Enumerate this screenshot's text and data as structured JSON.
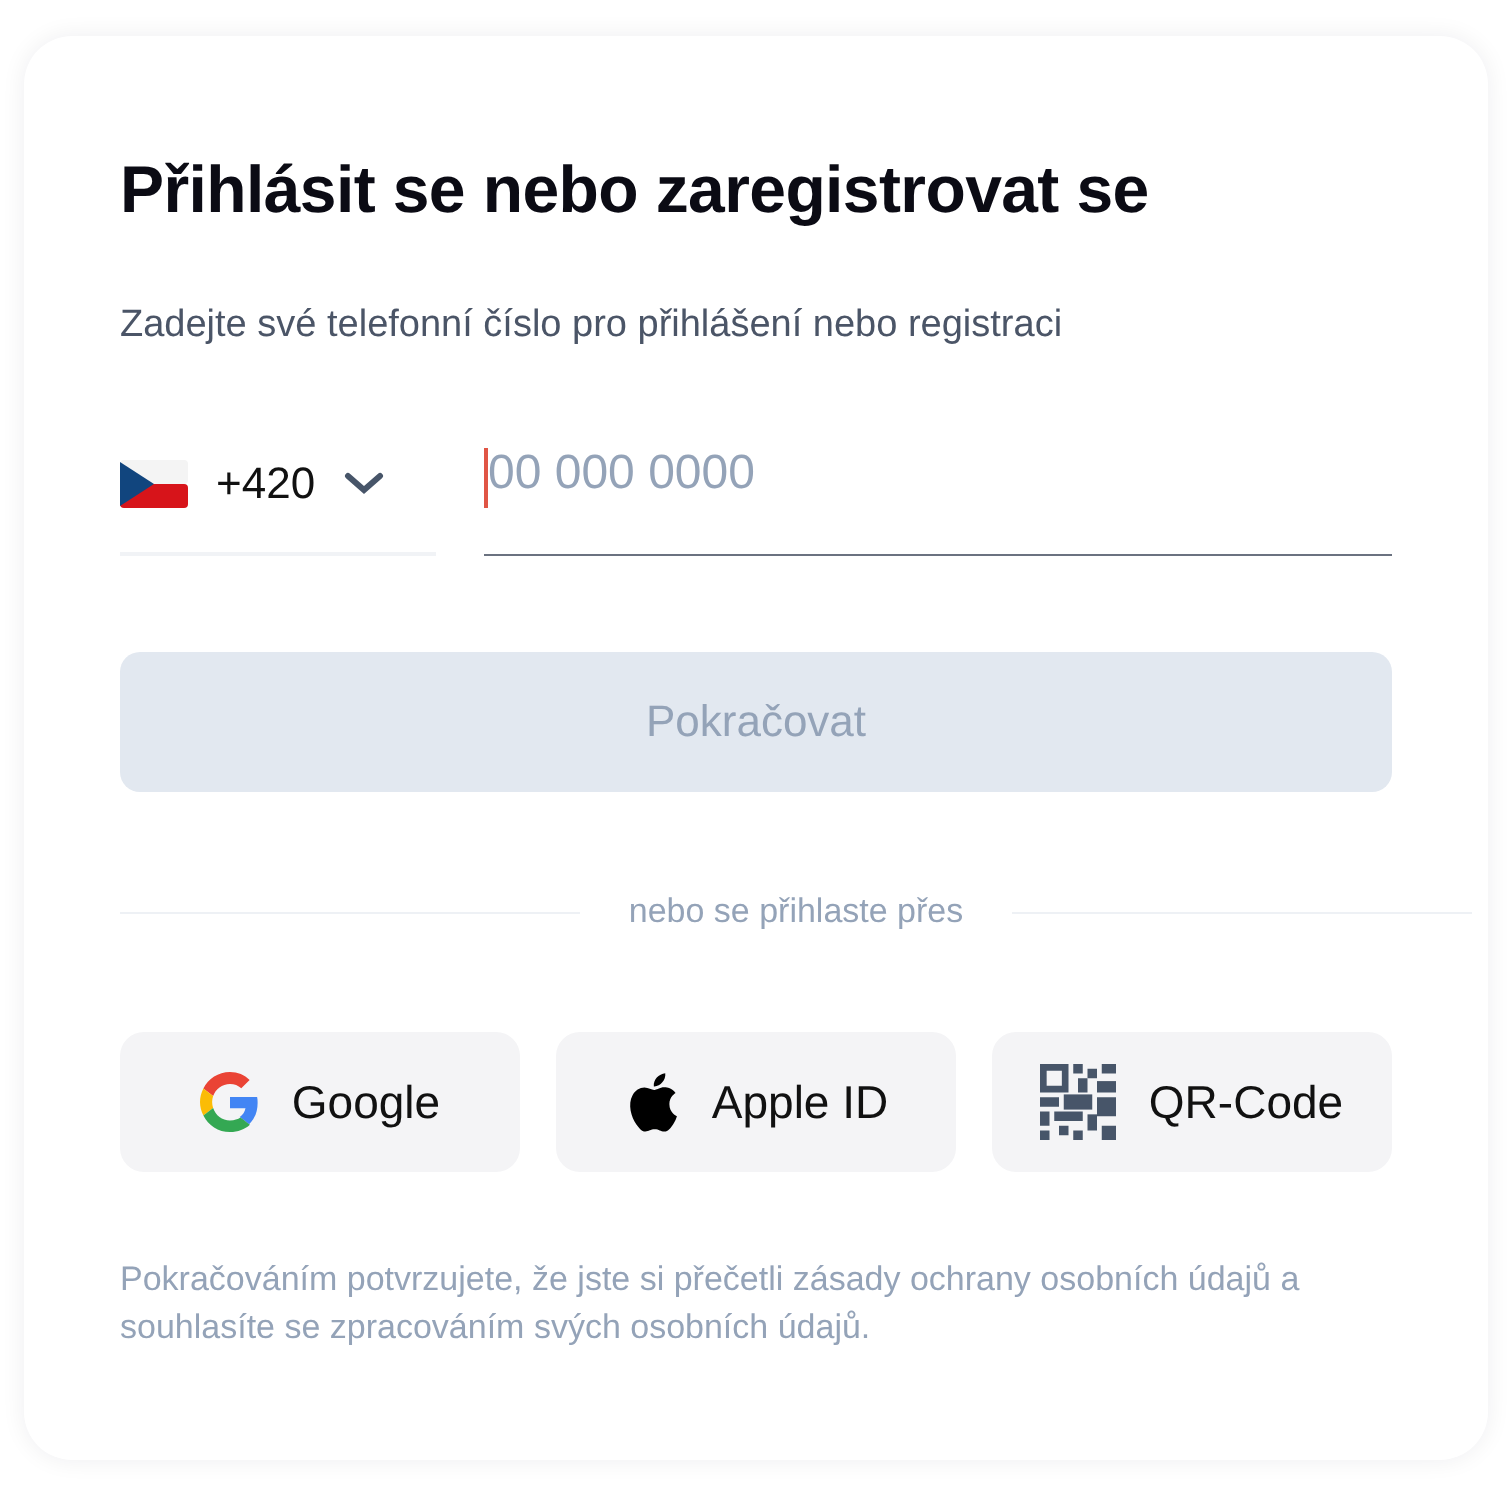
{
  "title": "Přihlásit se nebo zaregistrovat se",
  "subtitle": "Zadejte své telefonní číslo pro přihlášení nebo registraci",
  "phone": {
    "country_code": "+420",
    "placeholder": "00 000 0000"
  },
  "continue_button": {
    "label": "Pokračovat",
    "disabled": true
  },
  "divider_text": "nebo se přihlaste přes",
  "social_buttons": [
    {
      "kind": "google",
      "label": "Google"
    },
    {
      "kind": "apple",
      "label": "Apple ID"
    },
    {
      "kind": "qr",
      "label": "QR-Code"
    }
  ],
  "footer": "Pokračováním potvrzujete, že jste si přečetli zásady ochrany osobních údajů a souhlasíte se zpracováním svých osobních údajů."
}
